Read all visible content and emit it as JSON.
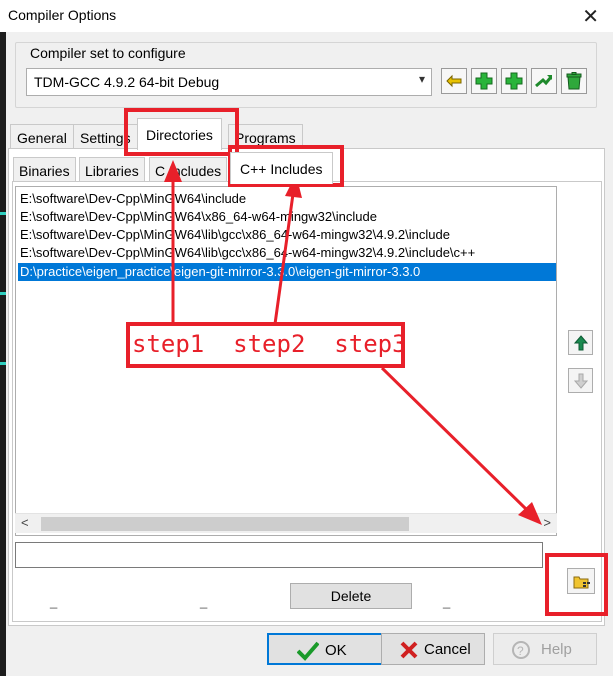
{
  "window": {
    "title": "Compiler Options",
    "close_glyph": "✕"
  },
  "compiler_set": {
    "label": "Compiler set to configure",
    "selected": "TDM-GCC 4.9.2 64-bit Debug"
  },
  "toolbar": {
    "icons": [
      "rename-icon",
      "add-icon",
      "add-from-folder-icon",
      "find-icon",
      "delete-set-icon"
    ]
  },
  "outer_tabs": [
    "General",
    "Settings",
    "Directories",
    "Programs"
  ],
  "inner_tabs": [
    "Binaries",
    "Libraries",
    "C Includes",
    "C++ Includes"
  ],
  "directories": [
    "E:\\software\\Dev-Cpp\\MinGW64\\include",
    "E:\\software\\Dev-Cpp\\MinGW64\\x86_64-w64-mingw32\\include",
    "E:\\software\\Dev-Cpp\\MinGW64\\lib\\gcc\\x86_64-w64-mingw32\\4.9.2\\include",
    "E:\\software\\Dev-Cpp\\MinGW64\\lib\\gcc\\x86_64-w64-mingw32\\4.9.2\\include\\c++",
    "D:\\practice\\eigen_practice\\eigen-git-mirror-3.3.0\\eigen-git-mirror-3.3.0"
  ],
  "selected_index": 4,
  "scrollbar": {
    "left": "<",
    "right": ">"
  },
  "path_input": {
    "value": ""
  },
  "underscores": [
    "_",
    "_",
    "_"
  ],
  "buttons": {
    "delete": "Delete",
    "ok": "OK",
    "cancel": "Cancel",
    "help": "Help"
  },
  "annotation": {
    "steps": "step1  step2  step3",
    "color": "#e8202a"
  },
  "colors": {
    "selection": "#0078d7",
    "annotation": "#e8202a",
    "ok_border": "#0078d7"
  }
}
